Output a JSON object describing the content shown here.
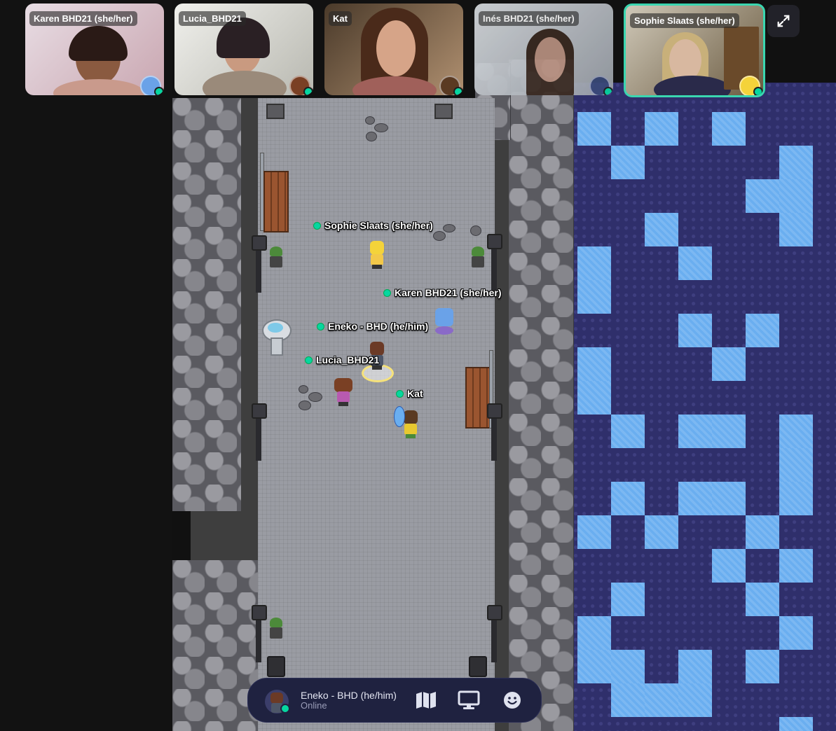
{
  "video_tiles": [
    {
      "name": "Karen BHD21 (she/her)"
    },
    {
      "name": "Lucia_BHD21"
    },
    {
      "name": "Kat"
    },
    {
      "name": "Inés BHD21 (she/her)"
    },
    {
      "name": "Sophie Slaats (she/her)"
    }
  ],
  "map_players": [
    {
      "name": "Sophie Slaats (she/her)"
    },
    {
      "name": "Karen BHD21 (she/her)"
    },
    {
      "name": "Eneko - BHD (he/him)"
    },
    {
      "name": "Lucia_BHD21"
    },
    {
      "name": "Kat"
    }
  ],
  "bottom_bar": {
    "user_name": "Eneko - BHD (he/him)",
    "status": "Online"
  },
  "icons": [
    "expand-icon",
    "map-icon",
    "screen-share-icon",
    "emoji-icon"
  ],
  "colors": {
    "online": "#06d6a0",
    "water": "#6aaef0",
    "deep_water": "#2f2f6b",
    "bar_bg": "#1f2240",
    "active_tile_border": "#3ad6b0"
  }
}
